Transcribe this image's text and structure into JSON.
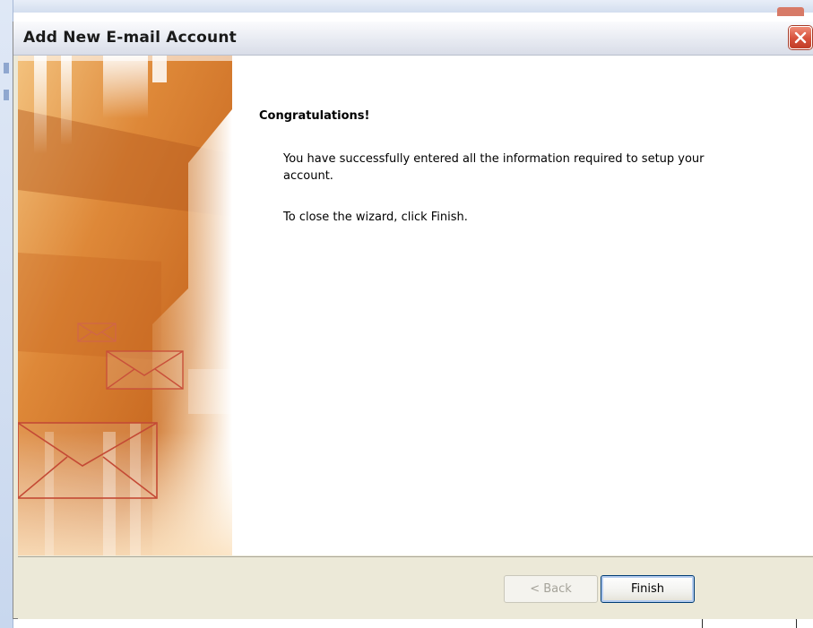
{
  "dialog": {
    "title": "Add New E-mail Account"
  },
  "content": {
    "heading": "Congratulations!",
    "paragraph1": "You have successfully entered all the information required to setup your account.",
    "paragraph2": "To close the wizard, click Finish."
  },
  "buttons": {
    "back_label": "< Back",
    "back_enabled": false,
    "finish_label": "Finish"
  },
  "icons": {
    "close": "close-icon",
    "envelopes": "envelope-icon"
  },
  "colors": {
    "sidebar_orange": "#e1883a",
    "close_red": "#d6503a",
    "dialog_face": "#ece9d8",
    "finish_border": "#003c74"
  }
}
